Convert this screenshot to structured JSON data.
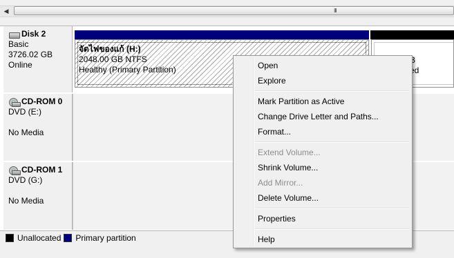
{
  "scrollbar": {
    "grip": "III"
  },
  "disks": [
    {
      "name": "Disk 2",
      "type": "Basic",
      "size": "3726.02 GB",
      "status": "Online",
      "icon": "hard-disk-icon"
    },
    {
      "name": "CD-ROM 0",
      "type": "DVD (E:)",
      "media": "No Media",
      "icon": "cdrom-icon"
    },
    {
      "name": "CD-ROM 1",
      "type": "DVD (G:)",
      "media": "No Media",
      "icon": "cdrom-icon"
    }
  ],
  "partitions": {
    "primary": {
      "title": "จัดไฟของแก้  (H:)",
      "size": "2048.00 GB NTFS",
      "status": "Healthy (Primary Partition)"
    },
    "unallocated": {
      "line1": "B",
      "line2": "ed"
    }
  },
  "legend": [
    {
      "label": "Unallocated",
      "color": "#000000"
    },
    {
      "label": "Primary partition",
      "color": "#00007f"
    }
  ],
  "colors": {
    "primary_header": "#00007f",
    "unallocated_header": "#000000"
  },
  "context_menu": {
    "items": [
      {
        "label": "Open",
        "enabled": true
      },
      {
        "label": "Explore",
        "enabled": true
      },
      {
        "label": "Mark Partition as Active",
        "enabled": true
      },
      {
        "label": "Change Drive Letter and Paths...",
        "enabled": true
      },
      {
        "label": "Format...",
        "enabled": true
      },
      {
        "label": "Extend Volume...",
        "enabled": false
      },
      {
        "label": "Shrink Volume...",
        "enabled": true
      },
      {
        "label": "Add Mirror...",
        "enabled": false
      },
      {
        "label": "Delete Volume...",
        "enabled": true
      },
      {
        "label": "Properties",
        "enabled": true
      },
      {
        "label": "Help",
        "enabled": true
      }
    ]
  }
}
